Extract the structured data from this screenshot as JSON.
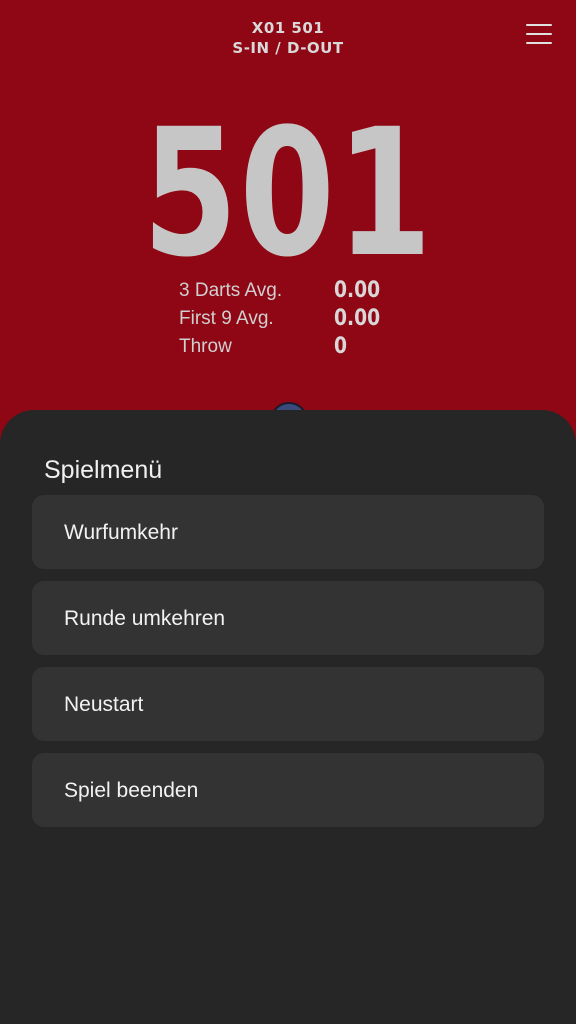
{
  "header": {
    "mode": "X01 501",
    "rules": "S-IN / D-OUT",
    "menu_icon": "hamburger-menu-icon"
  },
  "player": {
    "score": "501",
    "stats": [
      {
        "label": "3 Darts Avg.",
        "value": "0.00"
      },
      {
        "label": "First 9 Avg.",
        "value": "0.00"
      },
      {
        "label": "Throw",
        "value": "0"
      }
    ]
  },
  "game_menu": {
    "title": "Spielmenü",
    "items": [
      {
        "label": "Wurfumkehr"
      },
      {
        "label": "Runde umkehren"
      },
      {
        "label": "Neustart"
      },
      {
        "label": "Spiel beenden"
      }
    ]
  },
  "colors": {
    "background": "#8f0714",
    "sheet": "#262626",
    "item": "#333333"
  }
}
